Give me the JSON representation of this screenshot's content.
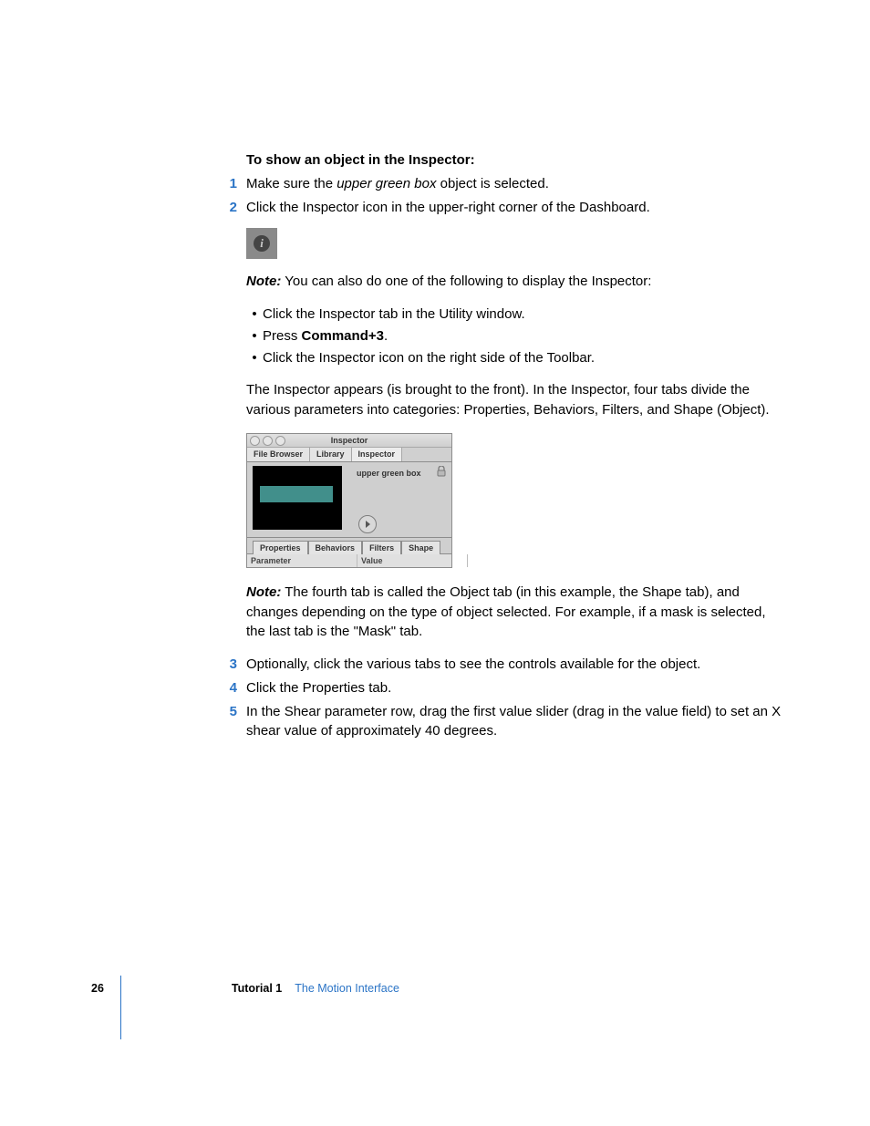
{
  "heading": "To show an object in the Inspector:",
  "steps": {
    "s1": {
      "num": "1",
      "pre": "Make sure the ",
      "italic": "upper green box",
      "post": " object is selected."
    },
    "s2": {
      "num": "2",
      "text": "Click the Inspector icon in the upper-right corner of the Dashboard."
    },
    "s3": {
      "num": "3",
      "text": "Optionally, click the various tabs to see the controls available for the object."
    },
    "s4": {
      "num": "4",
      "text": "Click the Properties tab."
    },
    "s5": {
      "num": "5",
      "text": "In the Shear parameter row, drag the first value slider (drag in the value field) to set an X shear value of approximately 40 degrees."
    }
  },
  "note1": {
    "label": "Note:",
    "text": "  You can also do one of the following to display the Inspector:"
  },
  "bullets": {
    "b1": "Click the Inspector tab in the Utility window.",
    "b2_pre": "Press ",
    "b2_bold": "Command+3",
    "b2_post": ".",
    "b3": "Click the Inspector icon on the right side of the Toolbar."
  },
  "para1": "The Inspector appears (is brought to the front). In the Inspector, four tabs divide the various parameters into categories:  Properties, Behaviors, Filters, and Shape (Object).",
  "note2": {
    "label": "Note:",
    "text": "  The fourth tab is called the Object tab (in this example, the Shape tab), and changes depending on the type of object selected. For example, if a mask is selected, the last tab is the \"Mask\" tab."
  },
  "inspector": {
    "title": "Inspector",
    "tabs_top": {
      "t1": "File Browser",
      "t2": "Library",
      "t3": "Inspector"
    },
    "preview_label": "upper green box",
    "tabs_mid": {
      "t1": "Properties",
      "t2": "Behaviors",
      "t3": "Filters",
      "t4": "Shape"
    },
    "cols": {
      "c1": "Parameter",
      "c2": "Value"
    }
  },
  "footer": {
    "page": "26",
    "tutorial": "Tutorial 1",
    "title": "The Motion Interface"
  },
  "info_glyph": "i"
}
